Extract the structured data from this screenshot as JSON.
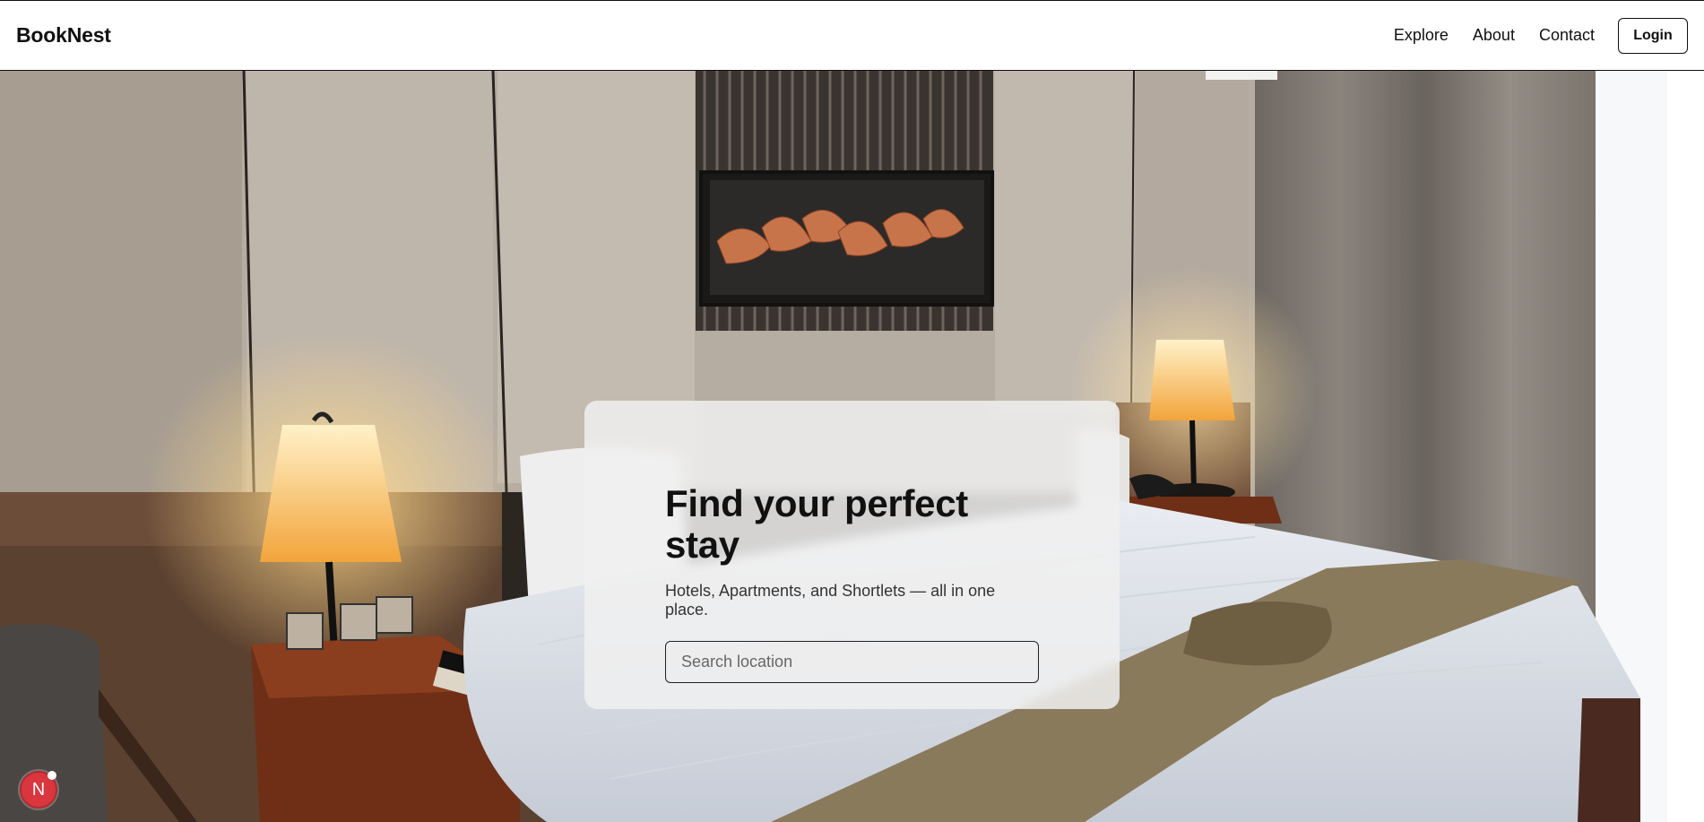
{
  "header": {
    "brand": "BookNest",
    "nav": [
      {
        "label": "Explore"
      },
      {
        "label": "About"
      },
      {
        "label": "Contact"
      }
    ],
    "login_label": "Login"
  },
  "hero": {
    "title": "Find your perfect stay",
    "subtitle": "Hotels, Apartments, and Shortlets — all in one place.",
    "search": {
      "placeholder": "Search location",
      "value": ""
    }
  },
  "badge": {
    "letter": "N"
  },
  "colors": {
    "accent": "#111111",
    "badge": "#d9363e",
    "card": "#f0f0f0"
  }
}
